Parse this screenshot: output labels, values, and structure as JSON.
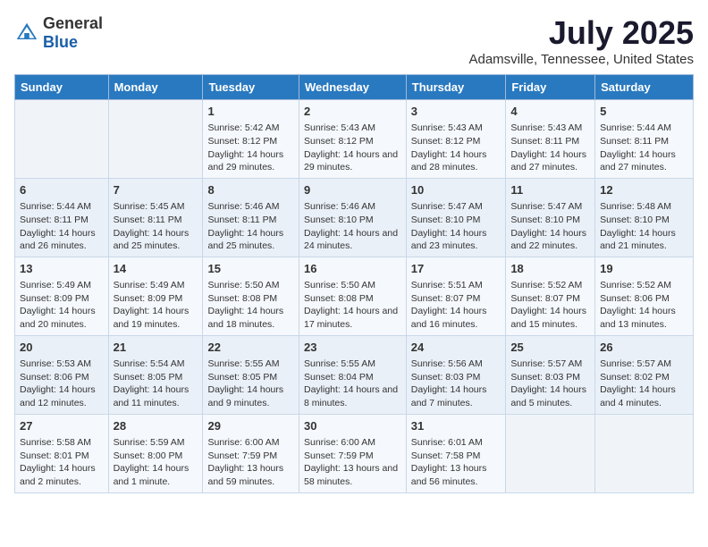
{
  "logo": {
    "general": "General",
    "blue": "Blue"
  },
  "title": "July 2025",
  "location": "Adamsville, Tennessee, United States",
  "weekdays": [
    "Sunday",
    "Monday",
    "Tuesday",
    "Wednesday",
    "Thursday",
    "Friday",
    "Saturday"
  ],
  "weeks": [
    [
      {
        "day": "",
        "info": ""
      },
      {
        "day": "",
        "info": ""
      },
      {
        "day": "1",
        "info": "Sunrise: 5:42 AM\nSunset: 8:12 PM\nDaylight: 14 hours and 29 minutes."
      },
      {
        "day": "2",
        "info": "Sunrise: 5:43 AM\nSunset: 8:12 PM\nDaylight: 14 hours and 29 minutes."
      },
      {
        "day": "3",
        "info": "Sunrise: 5:43 AM\nSunset: 8:12 PM\nDaylight: 14 hours and 28 minutes."
      },
      {
        "day": "4",
        "info": "Sunrise: 5:43 AM\nSunset: 8:11 PM\nDaylight: 14 hours and 27 minutes."
      },
      {
        "day": "5",
        "info": "Sunrise: 5:44 AM\nSunset: 8:11 PM\nDaylight: 14 hours and 27 minutes."
      }
    ],
    [
      {
        "day": "6",
        "info": "Sunrise: 5:44 AM\nSunset: 8:11 PM\nDaylight: 14 hours and 26 minutes."
      },
      {
        "day": "7",
        "info": "Sunrise: 5:45 AM\nSunset: 8:11 PM\nDaylight: 14 hours and 25 minutes."
      },
      {
        "day": "8",
        "info": "Sunrise: 5:46 AM\nSunset: 8:11 PM\nDaylight: 14 hours and 25 minutes."
      },
      {
        "day": "9",
        "info": "Sunrise: 5:46 AM\nSunset: 8:10 PM\nDaylight: 14 hours and 24 minutes."
      },
      {
        "day": "10",
        "info": "Sunrise: 5:47 AM\nSunset: 8:10 PM\nDaylight: 14 hours and 23 minutes."
      },
      {
        "day": "11",
        "info": "Sunrise: 5:47 AM\nSunset: 8:10 PM\nDaylight: 14 hours and 22 minutes."
      },
      {
        "day": "12",
        "info": "Sunrise: 5:48 AM\nSunset: 8:10 PM\nDaylight: 14 hours and 21 minutes."
      }
    ],
    [
      {
        "day": "13",
        "info": "Sunrise: 5:49 AM\nSunset: 8:09 PM\nDaylight: 14 hours and 20 minutes."
      },
      {
        "day": "14",
        "info": "Sunrise: 5:49 AM\nSunset: 8:09 PM\nDaylight: 14 hours and 19 minutes."
      },
      {
        "day": "15",
        "info": "Sunrise: 5:50 AM\nSunset: 8:08 PM\nDaylight: 14 hours and 18 minutes."
      },
      {
        "day": "16",
        "info": "Sunrise: 5:50 AM\nSunset: 8:08 PM\nDaylight: 14 hours and 17 minutes."
      },
      {
        "day": "17",
        "info": "Sunrise: 5:51 AM\nSunset: 8:07 PM\nDaylight: 14 hours and 16 minutes."
      },
      {
        "day": "18",
        "info": "Sunrise: 5:52 AM\nSunset: 8:07 PM\nDaylight: 14 hours and 15 minutes."
      },
      {
        "day": "19",
        "info": "Sunrise: 5:52 AM\nSunset: 8:06 PM\nDaylight: 14 hours and 13 minutes."
      }
    ],
    [
      {
        "day": "20",
        "info": "Sunrise: 5:53 AM\nSunset: 8:06 PM\nDaylight: 14 hours and 12 minutes."
      },
      {
        "day": "21",
        "info": "Sunrise: 5:54 AM\nSunset: 8:05 PM\nDaylight: 14 hours and 11 minutes."
      },
      {
        "day": "22",
        "info": "Sunrise: 5:55 AM\nSunset: 8:05 PM\nDaylight: 14 hours and 9 minutes."
      },
      {
        "day": "23",
        "info": "Sunrise: 5:55 AM\nSunset: 8:04 PM\nDaylight: 14 hours and 8 minutes."
      },
      {
        "day": "24",
        "info": "Sunrise: 5:56 AM\nSunset: 8:03 PM\nDaylight: 14 hours and 7 minutes."
      },
      {
        "day": "25",
        "info": "Sunrise: 5:57 AM\nSunset: 8:03 PM\nDaylight: 14 hours and 5 minutes."
      },
      {
        "day": "26",
        "info": "Sunrise: 5:57 AM\nSunset: 8:02 PM\nDaylight: 14 hours and 4 minutes."
      }
    ],
    [
      {
        "day": "27",
        "info": "Sunrise: 5:58 AM\nSunset: 8:01 PM\nDaylight: 14 hours and 2 minutes."
      },
      {
        "day": "28",
        "info": "Sunrise: 5:59 AM\nSunset: 8:00 PM\nDaylight: 14 hours and 1 minute."
      },
      {
        "day": "29",
        "info": "Sunrise: 6:00 AM\nSunset: 7:59 PM\nDaylight: 13 hours and 59 minutes."
      },
      {
        "day": "30",
        "info": "Sunrise: 6:00 AM\nSunset: 7:59 PM\nDaylight: 13 hours and 58 minutes."
      },
      {
        "day": "31",
        "info": "Sunrise: 6:01 AM\nSunset: 7:58 PM\nDaylight: 13 hours and 56 minutes."
      },
      {
        "day": "",
        "info": ""
      },
      {
        "day": "",
        "info": ""
      }
    ]
  ]
}
